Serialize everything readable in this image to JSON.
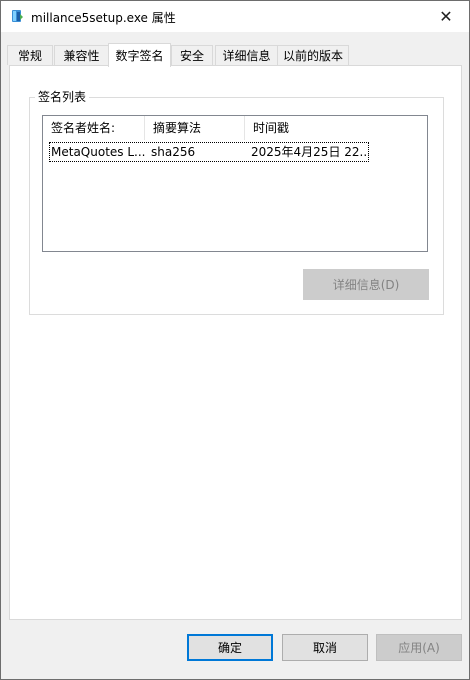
{
  "window": {
    "title": "millance5setup.exe 属性",
    "close_symbol": "✕",
    "icon": "installer-icon"
  },
  "tabs": [
    {
      "label": "常规",
      "active": false
    },
    {
      "label": "兼容性",
      "active": false
    },
    {
      "label": "数字签名",
      "active": true
    },
    {
      "label": "安全",
      "active": false
    },
    {
      "label": "详细信息",
      "active": false
    },
    {
      "label": "以前的版本",
      "active": false
    }
  ],
  "signatures": {
    "group_title": "签名列表",
    "columns": [
      "签名者姓名:",
      "摘要算法",
      "时间戳"
    ],
    "rows": [
      {
        "name": "MetaQuotes L...",
        "algorithm": "sha256",
        "timestamp": "2025年4月25日 22..."
      }
    ],
    "details_button": "详细信息(D)"
  },
  "footer": {
    "ok": "确定",
    "cancel": "取消",
    "apply": "应用(A)"
  },
  "colors": {
    "accent": "#0078d7",
    "disabled_bg": "#cccccc",
    "disabled_text": "#838383"
  }
}
